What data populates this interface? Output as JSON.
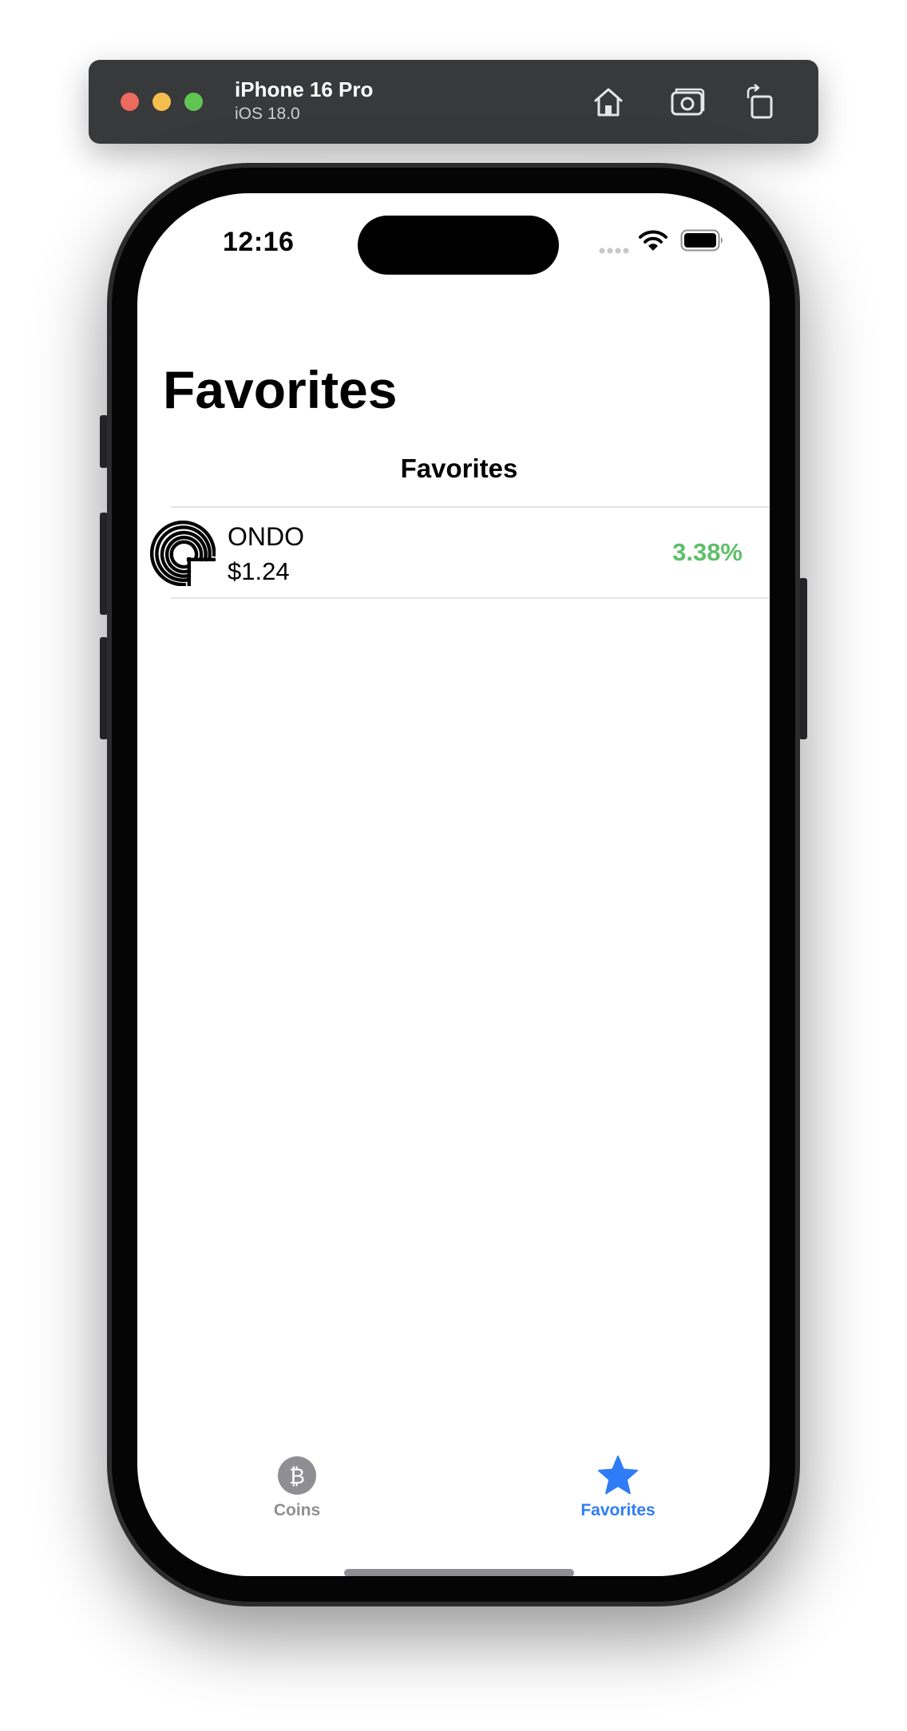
{
  "simulator": {
    "device_name": "iPhone 16 Pro",
    "os_version": "iOS 18.0"
  },
  "status_bar": {
    "time": "12:16"
  },
  "nav": {
    "large_title": "Favorites"
  },
  "list": {
    "section_header": "Favorites",
    "rows": [
      {
        "symbol": "ONDO",
        "price": "$1.24",
        "change": "3.38%",
        "change_color": "#5fbf6a"
      }
    ]
  },
  "tab_bar": {
    "tabs": [
      {
        "label": "Coins",
        "icon": "bitcoin-icon",
        "selected": false
      },
      {
        "label": "Favorites",
        "icon": "star-icon",
        "selected": true
      }
    ],
    "selected_color": "#2f7cf6",
    "unselected_color": "#8e8e93"
  }
}
